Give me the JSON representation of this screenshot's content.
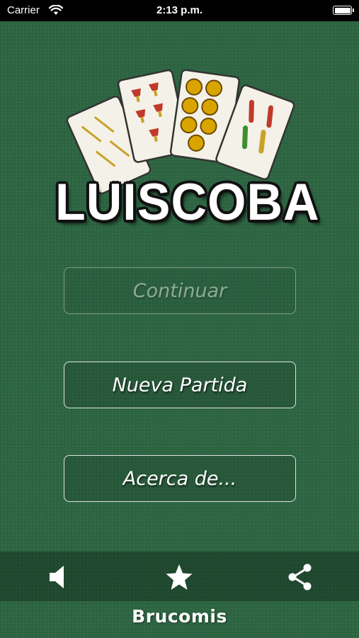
{
  "status_bar": {
    "carrier": "Carrier",
    "time": "2:13 p.m.",
    "icons": [
      "wifi-icon",
      "battery-icon"
    ],
    "battery_level": 1.0
  },
  "logo": {
    "title": "LUISCOBA"
  },
  "menu": {
    "continue_label": "Continuar",
    "continue_enabled": false,
    "new_game_label": "Nueva Partida",
    "about_label": "Acerca de..."
  },
  "toolbar": {
    "icons": [
      "speaker-icon",
      "star-icon",
      "share-icon"
    ]
  },
  "footer": {
    "brand": "Brucomis"
  },
  "colors": {
    "background": "#2f6a45",
    "button_text": "#ffffff",
    "status_bar": "#000000"
  }
}
